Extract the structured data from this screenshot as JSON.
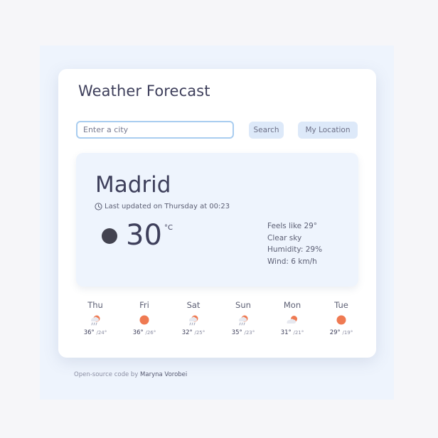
{
  "app": {
    "title": "Weather Forecast"
  },
  "search": {
    "placeholder": "Enter a city",
    "value": "",
    "search_label": "Search",
    "location_label": "My Location"
  },
  "current": {
    "city": "Madrid",
    "updated": "Last updated on Thursday at 00:23",
    "temperature": "30",
    "unit": "°C",
    "icon": "dark-dot-icon",
    "feels_like": "Feels like 29°",
    "description": "Clear sky",
    "humidity": "Humidity: 29%",
    "wind": "Wind: 6 km/h"
  },
  "forecast": [
    {
      "day": "Thu",
      "max": "36°",
      "min": "/24°",
      "icon": "rain-sun-icon"
    },
    {
      "day": "Fri",
      "max": "36°",
      "min": "/26°",
      "icon": "sun-icon"
    },
    {
      "day": "Sat",
      "max": "32°",
      "min": "/25°",
      "icon": "rain-sun-icon"
    },
    {
      "day": "Sun",
      "max": "35°",
      "min": "/23°",
      "icon": "rain-sun-icon"
    },
    {
      "day": "Mon",
      "max": "31°",
      "min": "/21°",
      "icon": "cloud-sun-icon"
    },
    {
      "day": "Tue",
      "max": "29°",
      "min": "/19°",
      "icon": "sun-icon"
    }
  ],
  "footer": {
    "link_text": "Open-source code",
    "by_text": "by",
    "author": "Maryna Vorobei"
  },
  "colors": {
    "accent_blue": "#dde9f9",
    "panel_bg": "#eef4fd",
    "sun_orange": "#ef7a52",
    "text_dark": "#3e3f5b"
  }
}
